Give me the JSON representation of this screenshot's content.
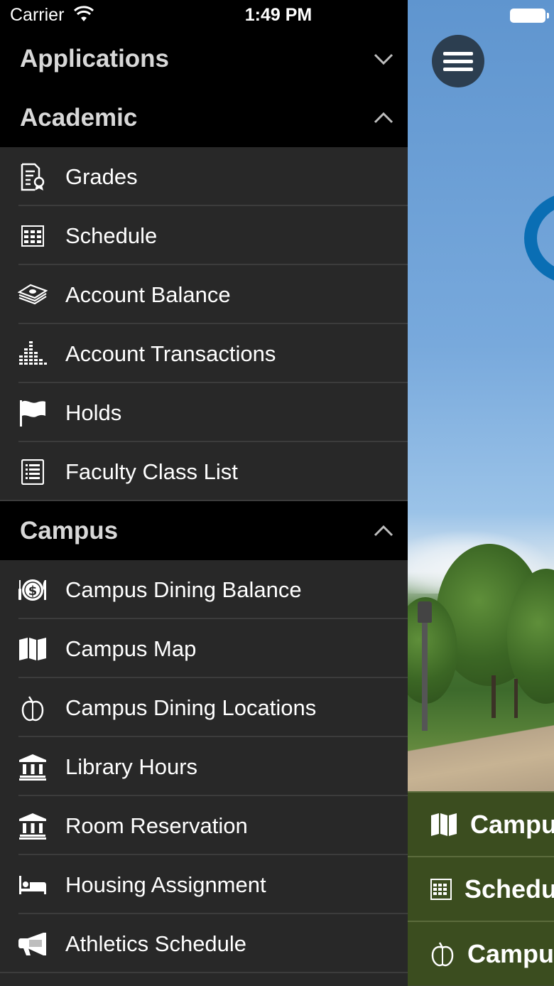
{
  "status": {
    "carrier": "Carrier",
    "time": "1:49 PM"
  },
  "sections": {
    "applications": {
      "title": "Applications"
    },
    "academic": {
      "title": "Academic",
      "items": [
        {
          "label": "Grades",
          "icon": "grades-icon"
        },
        {
          "label": "Schedule",
          "icon": "calendar-icon"
        },
        {
          "label": "Account Balance",
          "icon": "money-stack-icon"
        },
        {
          "label": "Account Transactions",
          "icon": "bar-chart-icon"
        },
        {
          "label": "Holds",
          "icon": "flag-icon"
        },
        {
          "label": "Faculty Class List",
          "icon": "list-icon"
        }
      ]
    },
    "campus": {
      "title": "Campus",
      "items": [
        {
          "label": "Campus Dining Balance",
          "icon": "dollar-plate-icon"
        },
        {
          "label": "Campus Map",
          "icon": "map-icon"
        },
        {
          "label": "Campus Dining Locations",
          "icon": "apple-icon"
        },
        {
          "label": "Library Hours",
          "icon": "bank-icon"
        },
        {
          "label": "Room Reservation",
          "icon": "bank-icon"
        },
        {
          "label": "Housing Assignment",
          "icon": "bed-icon"
        },
        {
          "label": "Athletics Schedule",
          "icon": "megaphone-icon"
        }
      ]
    }
  },
  "background": {
    "quick_links": [
      {
        "label": "Campu",
        "icon": "map-icon"
      },
      {
        "label": "Schedu",
        "icon": "calendar-icon"
      },
      {
        "label": "Campu",
        "icon": "apple-icon"
      }
    ]
  }
}
